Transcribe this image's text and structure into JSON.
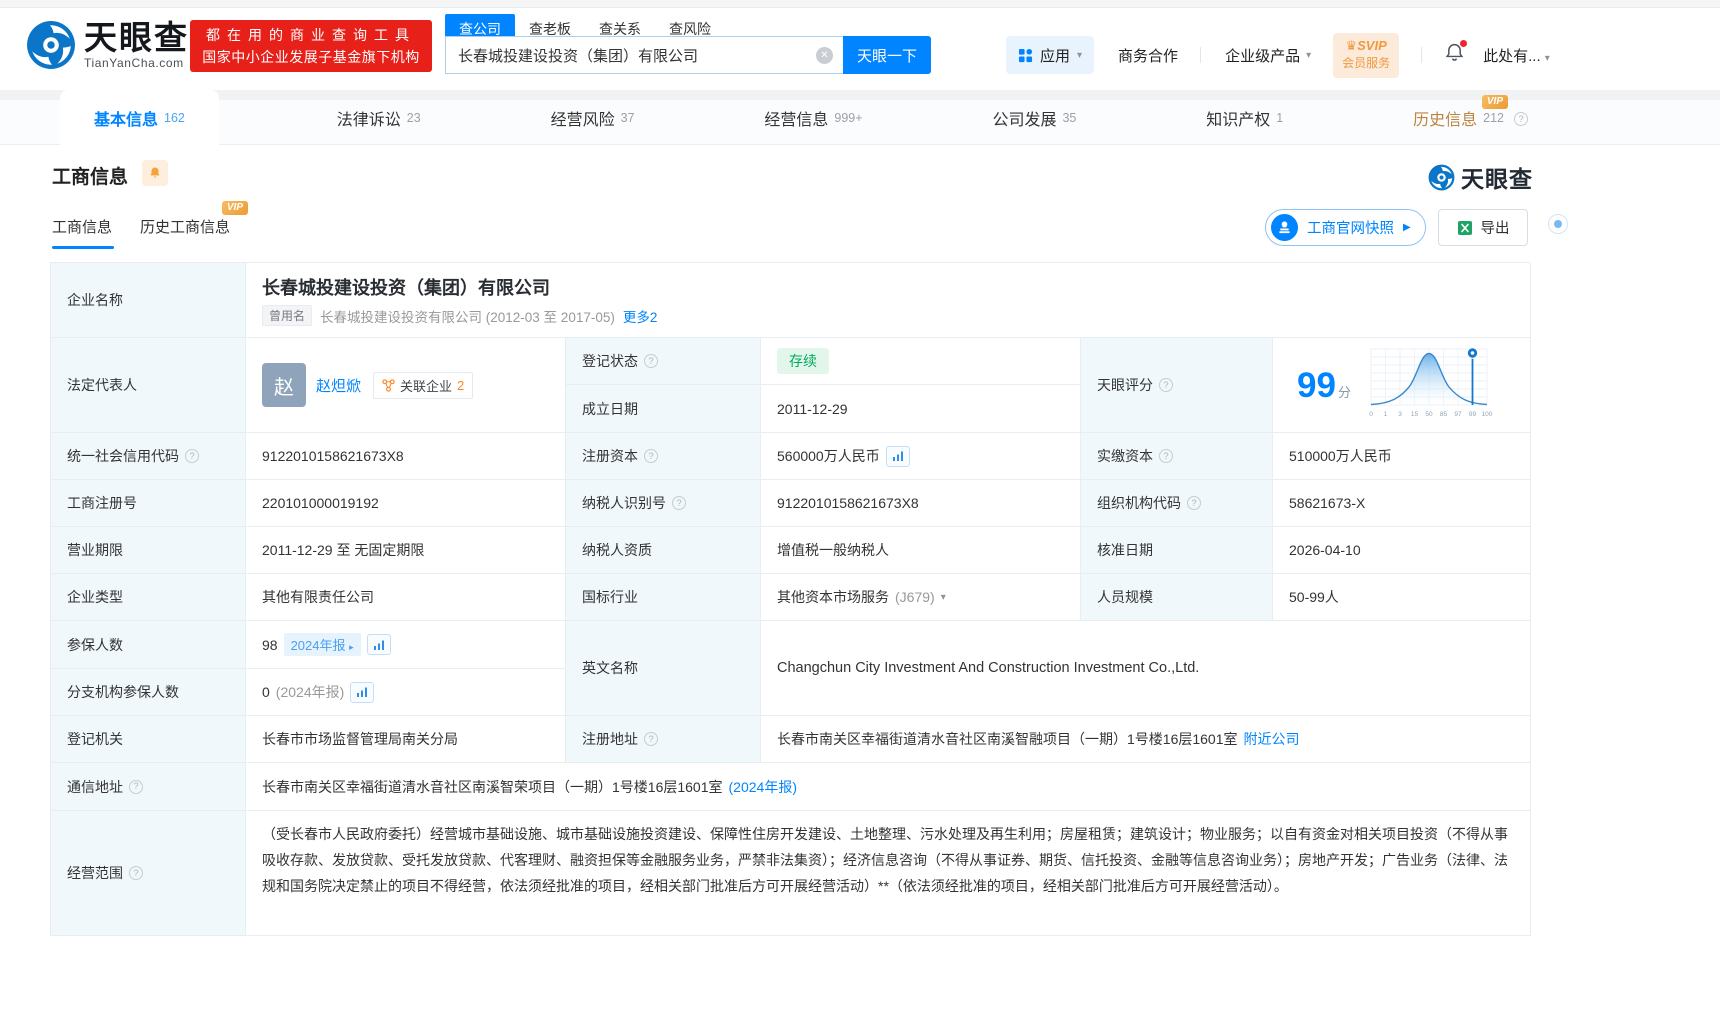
{
  "header": {
    "brand": "天眼查",
    "brand_domain": "TianYanCha.com",
    "promo_line1": "都在用的商业查询工具",
    "promo_line2": "国家中小企业发展子基金旗下机构",
    "search_tabs": [
      {
        "label": "查公司"
      },
      {
        "label": "查老板"
      },
      {
        "label": "查关系"
      },
      {
        "label": "查风险"
      }
    ],
    "search_value": "长春城投建设投资（集团）有限公司",
    "search_button": "天眼一下",
    "apps_label": "应用",
    "biz_label": "商务合作",
    "enterprise_label": "企业级产品",
    "svip_line1": "SVIP",
    "svip_line2": "会员服务",
    "user_label": "此处有..."
  },
  "nav_tabs": {
    "t0": {
      "label": "基本信息",
      "count": "162"
    },
    "t1": {
      "label": "法律诉讼",
      "count": "23"
    },
    "t2": {
      "label": "经营风险",
      "count": "37"
    },
    "t3": {
      "label": "经营信息",
      "count": "999+"
    },
    "t4": {
      "label": "公司发展",
      "count": "35"
    },
    "t5": {
      "label": "知识产权",
      "count": "1"
    },
    "t6": {
      "label": "历史信息",
      "count": "212",
      "vip": "VIP"
    }
  },
  "section": {
    "title": "工商信息",
    "brand": "天眼查",
    "subtab_active": "工商信息",
    "subtab_vip": "历史工商信息",
    "vip_tag": "VIP",
    "snapshot_button": "工商官网快照",
    "export_button": "导出"
  },
  "table": {
    "company_name": {
      "label": "企业名称",
      "value": "长春城投建设投资（集团）有限公司",
      "former_tag": "曾用名",
      "former": "长春城投建设投资有限公司 (2012-03 至 2017-05)",
      "more": "更多2"
    },
    "legal_rep": {
      "label": "法定代表人",
      "avatar": "赵",
      "name": "赵炟焮",
      "related_label": "关联企业",
      "related_count": "2"
    },
    "reg_status": {
      "label": "登记状态",
      "value": "存续"
    },
    "establish_date": {
      "label": "成立日期",
      "value": "2011-12-29"
    },
    "tyc_score": {
      "label": "天眼评分",
      "score": "99",
      "unit": "分"
    },
    "credit_code": {
      "label": "统一社会信用代码",
      "value": "9122010158621673X8"
    },
    "reg_capital": {
      "label": "注册资本",
      "value": "560000万人民币"
    },
    "paid_capital": {
      "label": "实缴资本",
      "value": "510000万人民币"
    },
    "reg_number": {
      "label": "工商注册号",
      "value": "220101000019192"
    },
    "taxpayer_id": {
      "label": "纳税人识别号",
      "value": "9122010158621673X8"
    },
    "org_code": {
      "label": "组织机构代码",
      "value": "58621673-X"
    },
    "business_term": {
      "label": "营业期限",
      "value": "2011-12-29 至 无固定期限"
    },
    "taxpayer_quality": {
      "label": "纳税人资质",
      "value": "增值税一般纳税人"
    },
    "approval_date": {
      "label": "核准日期",
      "value": "2026-04-10"
    },
    "company_type": {
      "label": "企业类型",
      "value": "其他有限责任公司"
    },
    "industry": {
      "label": "国标行业",
      "value": "其他资本市场服务",
      "code": "(J679)"
    },
    "staff_size": {
      "label": "人员规模",
      "value": "50-99人"
    },
    "insured_count": {
      "label": "参保人数",
      "value": "98",
      "badge": "2024年报"
    },
    "branch_insured": {
      "label": "分支机构参保人数",
      "value": "0",
      "note": "(2024年报)"
    },
    "english_name": {
      "label": "英文名称",
      "value": "Changchun City Investment And Construction Investment Co.,Ltd."
    },
    "reg_authority": {
      "label": "登记机关",
      "value": "长春市市场监督管理局南关分局"
    },
    "reg_address": {
      "label": "注册地址",
      "value": "长春市南关区幸福街道清水音社区南溪智融项目（一期）1号楼16层1601室",
      "link": "附近公司"
    },
    "mail_address": {
      "label": "通信地址",
      "value": "长春市南关区幸福街道清水音社区南溪智荣项目（一期）1号楼16层1601室",
      "link": "(2024年报)"
    },
    "business_scope": {
      "label": "经营范围",
      "value": "（受长春市人民政府委托）经营城市基础设施、城市基础设施投资建设、保障性住房开发建设、土地整理、污水处理及再生利用；房屋租赁；建筑设计；物业服务；以自有资金对相关项目投资（不得从事吸收存款、发放贷款、受托发放贷款、代客理财、融资担保等金融服务业务，严禁非法集资）；经济信息咨询（不得从事证券、期货、信托投资、金融等信息咨询业务）；房地产开发；广告业务（法律、法规和国务院决定禁止的项目不得经营，依法须经批准的项目，经相关部门批准后方可开展经营活动）**（依法须经批准的项目，经相关部门批准后方可开展经营活动）。"
    }
  },
  "chart_data": {
    "type": "area",
    "title": "天眼评分",
    "score": 99,
    "x_ticks": [
      "0",
      "1",
      "3",
      "15",
      "50",
      "85",
      "97",
      "99",
      "100"
    ],
    "marker_at": "99",
    "curve": "normal-distribution",
    "grid": true
  },
  "colors": {
    "accent": "#0084ff",
    "promo_red": "#e7211a",
    "status_green": "#00ac5b",
    "vip_gold": "#f0a63f",
    "orange": "#ff8726"
  }
}
